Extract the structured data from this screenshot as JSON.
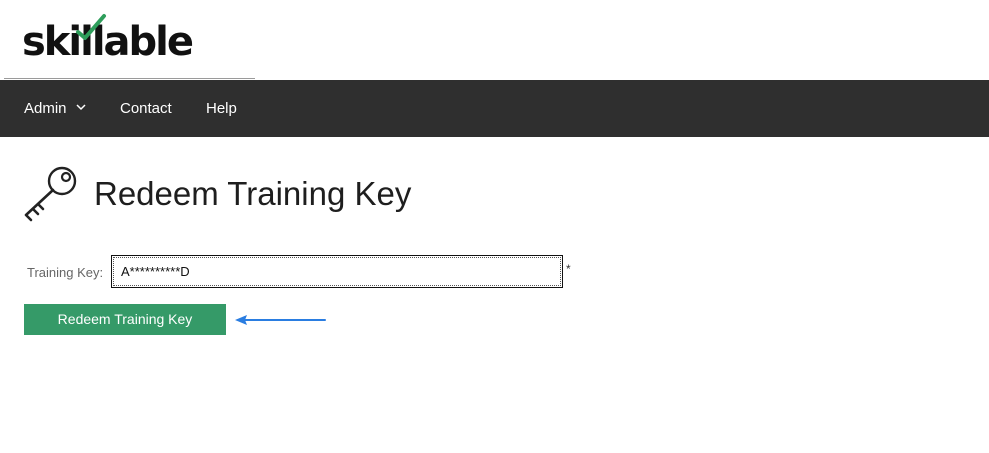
{
  "brand": {
    "name": "skillable",
    "accent_color": "#2e9e5b",
    "logo_icon": "checkmark-icon"
  },
  "nav": {
    "background": "#2f2f2f",
    "items": [
      {
        "label": "Admin",
        "has_dropdown": true
      },
      {
        "label": "Contact"
      },
      {
        "label": "Help"
      }
    ]
  },
  "page": {
    "icon": "key-icon",
    "title": "Redeem Training Key"
  },
  "form": {
    "training_key_label": "Training Key:",
    "training_key_value": "A**********D",
    "required_marker": "*",
    "submit_label": "Redeem Training Key",
    "submit_color": "#359a68"
  },
  "annotation": {
    "icon": "arrow-left-icon",
    "color": "#2a7de1"
  }
}
